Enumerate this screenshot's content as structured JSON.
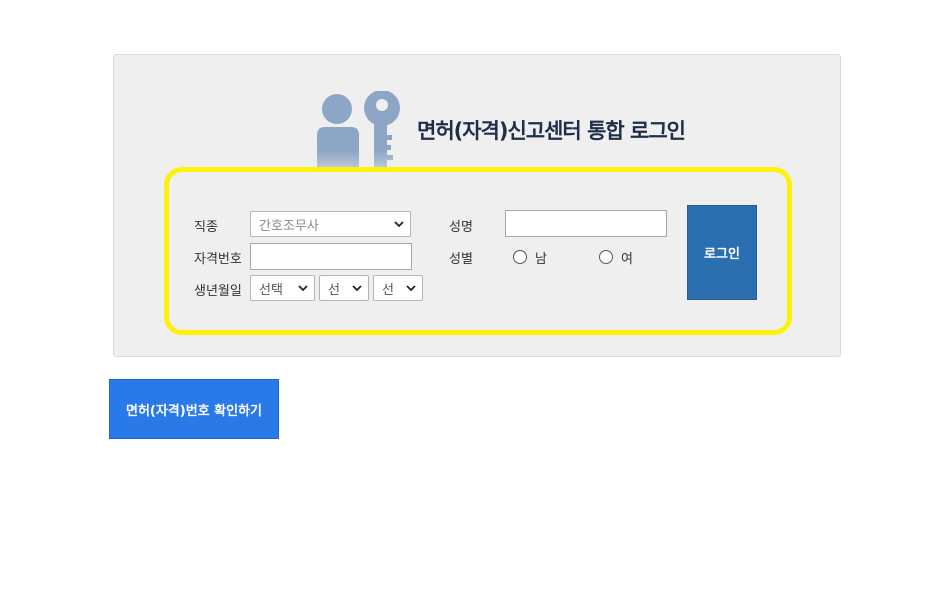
{
  "title": "면허(자격)신고센터 통합 로그인",
  "form": {
    "job_label": "직종",
    "job_selected": "간호조무사",
    "license_number_label": "자격번호",
    "license_number_value": "",
    "birth_label": "생년월일",
    "birth_year_selected": "선택",
    "birth_month_selected": "선",
    "birth_day_selected": "선",
    "name_label": "성명",
    "name_value": "",
    "gender_label": "성별",
    "gender_male": "남",
    "gender_female": "여",
    "login_button": "로그인"
  },
  "license_check_button": "면허(자격)번호 확인하기",
  "colors": {
    "highlight_border": "#fcf209",
    "login_button": "#2c6fb0",
    "check_button": "#2979e8",
    "icon": "#8ea6c5"
  },
  "icons": {
    "header": "user-key-icon",
    "select": "chevron-down-icon"
  }
}
